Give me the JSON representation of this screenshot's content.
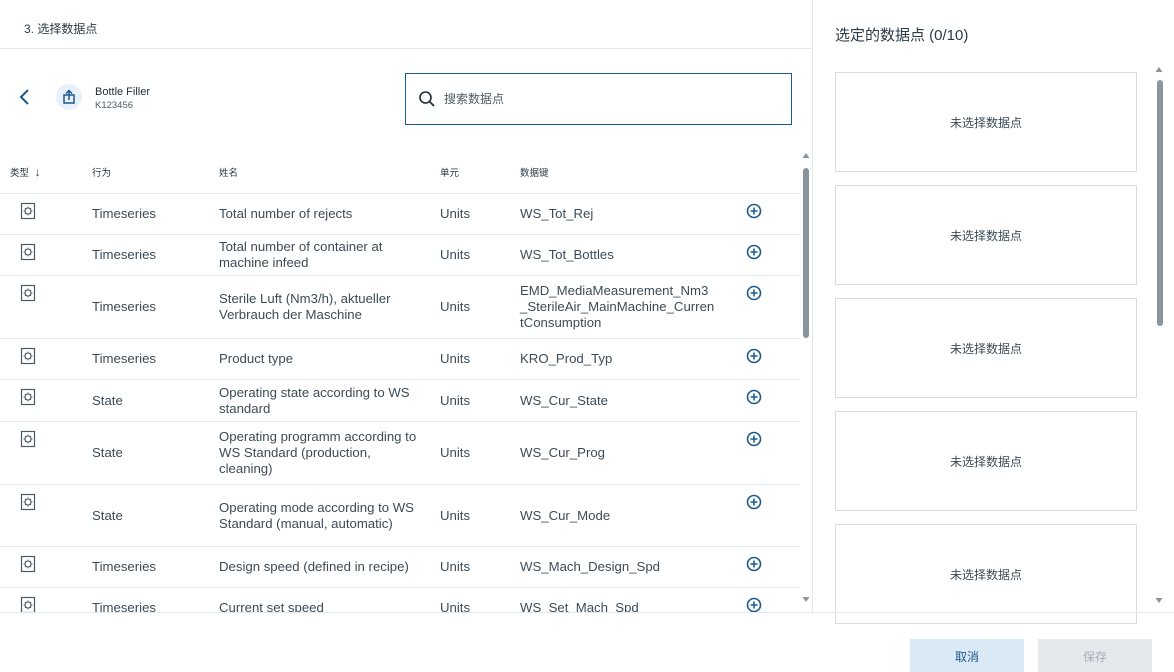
{
  "step": {
    "title": "3. 选择数据点"
  },
  "device": {
    "name": "Bottle Filler",
    "id": "K123456"
  },
  "search": {
    "placeholder": "搜索数据点"
  },
  "table": {
    "headers": {
      "type": "类型",
      "sort_arrow": "↓",
      "behavior": "行为",
      "name": "姓名",
      "unit": "单元",
      "key": "数据键"
    },
    "rows": [
      {
        "behavior": "Timeseries",
        "name": "Total number of rejects",
        "unit": "Units",
        "key": "WS_Tot_Rej"
      },
      {
        "behavior": "Timeseries",
        "name": "Total number of container at machine infeed",
        "unit": "Units",
        "key": "WS_Tot_Bottles"
      },
      {
        "behavior": "Timeseries",
        "name": "Sterile Luft (Nm3/h), aktueller Verbrauch der Maschine",
        "unit": "Units",
        "key": "EMD_MediaMeasurement_Nm3_SterileAir_MainMachine_CurrentConsumption"
      },
      {
        "behavior": "Timeseries",
        "name": "Product type",
        "unit": "Units",
        "key": "KRO_Prod_Typ"
      },
      {
        "behavior": "State",
        "name": "Operating state according to WS standard",
        "unit": "Units",
        "key": "WS_Cur_State"
      },
      {
        "behavior": "State",
        "name": "Operating programm according to WS Standard (production, cleaning)",
        "unit": "Units",
        "key": "WS_Cur_Prog"
      },
      {
        "behavior": "State",
        "name": "Operating mode according to WS Standard (manual, automatic)",
        "unit": "Units",
        "key": "WS_Cur_Mode"
      },
      {
        "behavior": "Timeseries",
        "name": "Design speed (defined in recipe)",
        "unit": "Units",
        "key": "WS_Mach_Design_Spd"
      },
      {
        "behavior": "Timeseries",
        "name": "Current set speed",
        "unit": "Units",
        "key": "WS_Set_Mach_Spd"
      }
    ]
  },
  "selection": {
    "title": "选定的数据点 (0/10)",
    "slots": [
      "未选择数据点",
      "未选择数据点",
      "未选择数据点",
      "未选择数据点",
      "未选择数据点"
    ]
  },
  "footer": {
    "cancel_label": "取消",
    "save_label": "保存"
  },
  "colors": {
    "accent": "#1d5b8e",
    "border": "#e3e8ec",
    "cancel_bg": "#dbe9f7",
    "save_disabled_bg": "#e6e9ec"
  },
  "icons": {
    "back": "chevron-left-icon",
    "device": "device-upload-icon",
    "search": "search-icon",
    "row_type": "datapoint-icon",
    "add": "plus-circle-icon",
    "sort": "arrow-down-icon"
  }
}
